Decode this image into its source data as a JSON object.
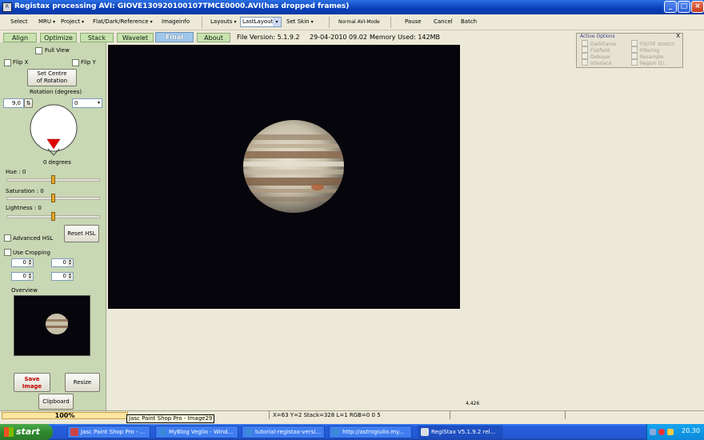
{
  "window": {
    "title": "Registax processing AVI: GIOVE130920100107TMCE0000.AVI(has dropped frames)",
    "app_icon": "regi"
  },
  "menu": {
    "items": [
      "Select",
      "MRU",
      "Project",
      "Flat/Dark/Reference",
      "Imageinfo",
      "Layouts",
      "Set Skin",
      "Normal AVI-Mode",
      "Pause",
      "Cancel",
      "Batch"
    ],
    "layout_value": "LastLayout"
  },
  "tabs": [
    "Align",
    "Optimize",
    "Stack",
    "Wavelet",
    "Final",
    "About"
  ],
  "active_tab": "Final",
  "info": {
    "file_version": "File Version: 5.1.9.2",
    "date": "29-04-2010 09.02",
    "memory": "Memory Used: 142MB"
  },
  "left": {
    "full_view": "Full View",
    "flip_x": "Flip X",
    "flip_y": "Flip Y",
    "set_centre_1": "Set Centre",
    "set_centre_2": "of Rotation",
    "rotation_label": "Rotation (degrees)",
    "rotation_value": "9,0",
    "rotation_combo": "0",
    "degrees_label": "0 degrees",
    "hue_label": "Hue : 0",
    "saturation_label": "Saturation : 0",
    "lightness_label": "Lightness : 0",
    "advanced_hsl": "Advanced HSL",
    "reset_hsl": "Reset HSL",
    "use_cropping": "Use Cropping",
    "crop_values": [
      "0",
      "0",
      "0",
      "0"
    ],
    "overview_label": "Overview",
    "save_image_1": "Save",
    "save_image_2": "Image",
    "resize": "Resize",
    "clipboard": "Clipboard"
  },
  "active_options": {
    "title": "Active Options",
    "close": "X",
    "items_left": [
      "Darkframe",
      "Flatfield",
      "Debayer",
      "Interlace"
    ],
    "items_right": [
      "FIV/TIF stretch",
      "Filtering",
      "Resample",
      "Region O.I."
    ]
  },
  "status": {
    "progress_percent": 100,
    "progress_text": "100%",
    "tooltip": "Jasc Paint Shop Pro - Image29",
    "info": "X=63 Y=2 Stack=328 L=1 RGB=0 0 5",
    "scale": "4,426"
  },
  "taskbar": {
    "start": "start",
    "tasks": [
      "Jasc Paint Shop Pro - ...",
      "MyBlog Veglio - Wind...",
      "tutorial-registax-versi...",
      "http://astrogiulio.my...",
      "RegiStax V5.1.9.2 rel..."
    ],
    "clock": "20.30"
  },
  "colors": {
    "titlebar": "#0a3fb8",
    "panel": "#c8d7b4",
    "tab_active": "#9ec7ea",
    "tab": "#c9e3b0",
    "progress": "#ffe5a0",
    "taskbar": "#245edb",
    "start": "#2f8a2f",
    "rotation_marker": "#e00000"
  }
}
